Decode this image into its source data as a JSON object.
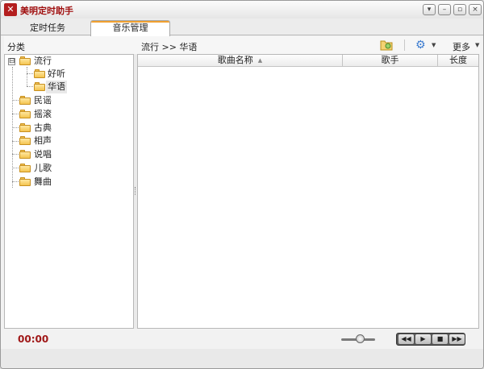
{
  "window": {
    "title": "美明定时助手",
    "icon": "app-logo-icon",
    "controls": [
      "collapse-icon",
      "minimize-icon",
      "restore-icon",
      "close-icon"
    ]
  },
  "tabs": [
    {
      "label": "定时任务",
      "active": false
    },
    {
      "label": "音乐管理",
      "active": true
    }
  ],
  "toolbar": {
    "left_header": "分类",
    "breadcrumb": "流行 >> 华语",
    "more_label": "更多",
    "icons": [
      "folder-add-icon",
      "gear-icon",
      "dropdown-arrow-icon"
    ]
  },
  "tree": {
    "root": {
      "label": "流行",
      "expanded": true,
      "expander": "⊟"
    },
    "children": [
      {
        "label": "好听"
      },
      {
        "label": "华语",
        "selected": true
      }
    ],
    "siblings": [
      {
        "label": "民谣"
      },
      {
        "label": "摇滚"
      },
      {
        "label": "古典"
      },
      {
        "label": "相声"
      },
      {
        "label": "说唱"
      },
      {
        "label": "儿歌"
      },
      {
        "label": "舞曲"
      }
    ]
  },
  "song_table": {
    "columns": [
      {
        "label": "歌曲名称",
        "sorted": "asc"
      },
      {
        "label": "歌手"
      },
      {
        "label": "长度"
      }
    ],
    "rows": []
  },
  "status": {
    "time": "00:00",
    "playback_controls": [
      "rewind-icon",
      "play-icon",
      "stop-icon",
      "fast-forward-icon"
    ]
  },
  "colors": {
    "accent": "#a01010",
    "tab_highlight": "#f0a030",
    "folder": "#f4c550"
  }
}
